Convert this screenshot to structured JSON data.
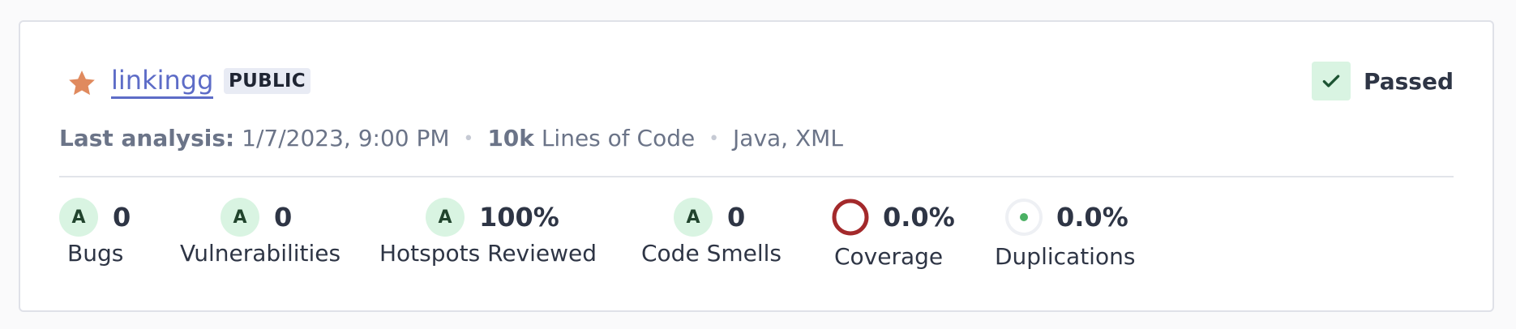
{
  "project": {
    "name": "linkingg",
    "visibility": "PUBLIC",
    "favorite": true,
    "favorite_color": "#e08a5e"
  },
  "quality_gate": {
    "status": "Passed",
    "color": "#d9f4e2"
  },
  "meta": {
    "last_analysis_label": "Last analysis:",
    "last_analysis_value": "1/7/2023, 9:00 PM",
    "loc_value": "10k",
    "loc_label": "Lines of Code",
    "languages": "Java, XML"
  },
  "measures": [
    {
      "rating": "A",
      "value": "0",
      "label": "Bugs"
    },
    {
      "rating": "A",
      "value": "0",
      "label": "Vulnerabilities"
    },
    {
      "rating": "A",
      "value": "100%",
      "label": "Hotspots Reviewed"
    },
    {
      "rating": "A",
      "value": "0",
      "label": "Code Smells"
    },
    {
      "icon": "coverage-ring-icon",
      "value": "0.0%",
      "label": "Coverage",
      "color": "#a3292b"
    },
    {
      "icon": "duplications-dot-icon",
      "value": "0.0%",
      "label": "Duplications",
      "color": "#4ab063"
    }
  ]
}
